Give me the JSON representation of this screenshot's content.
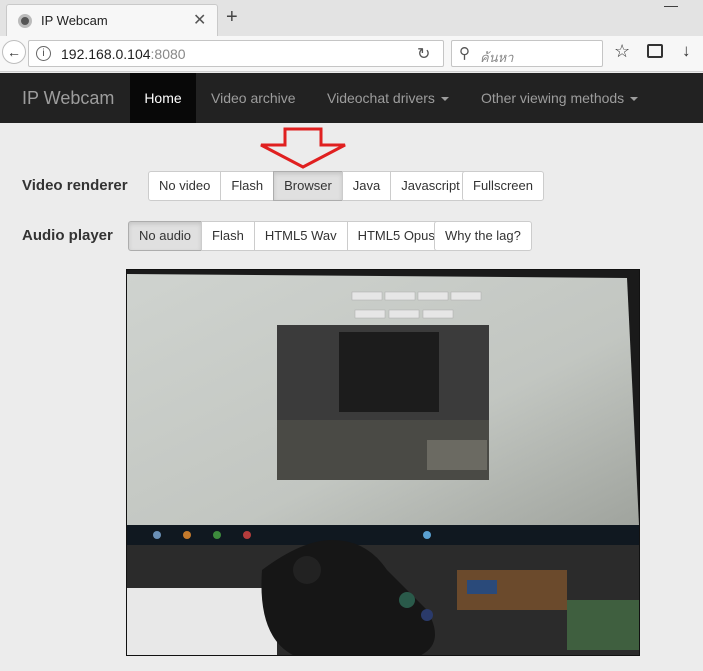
{
  "browser": {
    "tab_title": "IP Webcam",
    "tab_close": "✕",
    "new_tab": "+",
    "url_host": "192.168.0.104",
    "url_port": ":8080",
    "search_placeholder": "ค้นหา"
  },
  "navbar": {
    "brand": "IP Webcam",
    "items": [
      {
        "label": "Home",
        "active": true
      },
      {
        "label": "Video archive"
      },
      {
        "label": "Videochat drivers"
      },
      {
        "label": "Other viewing methods"
      }
    ]
  },
  "video_renderer": {
    "label": "Video renderer",
    "options": [
      "No video",
      "Flash",
      "Browser",
      "Java",
      "Javascript"
    ],
    "selected": "Browser",
    "fullscreen": "Fullscreen"
  },
  "audio_player": {
    "label": "Audio player",
    "options": [
      "No audio",
      "Flash",
      "HTML5 Wav",
      "HTML5 Opus"
    ],
    "selected": "No audio",
    "lag_help": "Why the lag?"
  },
  "colors": {
    "navbar_bg": "#222222",
    "arrow": "#e02020"
  }
}
